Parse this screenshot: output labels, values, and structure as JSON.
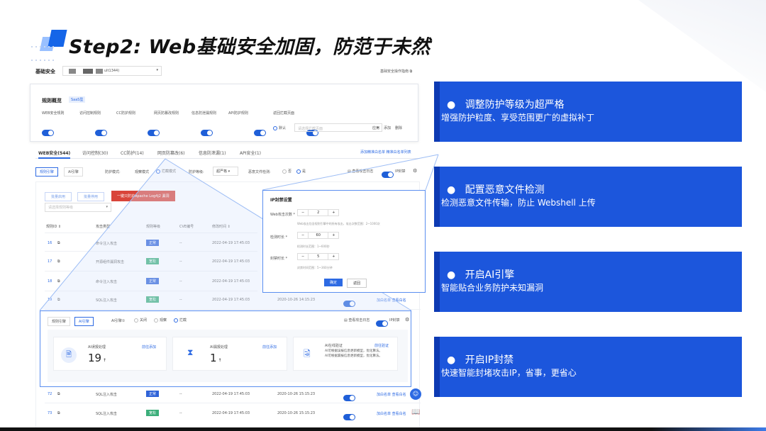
{
  "title": "Step2: Web基础安全加固，防范于未然",
  "header": {
    "section": "基础安全",
    "instance": "ult1344)",
    "guide": "基础安全操作指南"
  },
  "rules": {
    "title": "规则概览",
    "badge": "SaaS型",
    "items": [
      "WEB安全规则",
      "访问控制规则",
      "CC防护规则",
      "网页防篡改规则",
      "信息防泄漏规则",
      "API防护规则"
    ],
    "intercept": {
      "label": "返回拦截页面",
      "default": "默认",
      "placeholder": "请选择拦截页面",
      "actions": [
        "应用",
        "添加",
        "删除"
      ]
    }
  },
  "tabs": {
    "items": [
      "WEB安全(544)",
      "访问控制(30)",
      "CC防护(14)",
      "网页防篡改(6)",
      "信息防泄漏(1)",
      "API安全(1)"
    ],
    "right": "添加精准白名单 精准白名单列表"
  },
  "toolbar": {
    "tab1": "规则引擎",
    "tab2": "AI引擎",
    "mode_label": "防护模式:",
    "mode_watch": "观察模式",
    "mode_block": "拦截模式",
    "level_label": "防护等级:",
    "level_value": "超严格",
    "file_label": "恶意文件检测:",
    "file_no": "否",
    "file_yes": "是",
    "logs": "查看攻击日志",
    "ipban": "IP封禁"
  },
  "actions": {
    "enable": "批量启用",
    "disable": "批量停用",
    "log4j": "一键只防护Apache Log4j2 漏洞",
    "filter": "请选择规则等级"
  },
  "table": {
    "headers": [
      "规则ID",
      "攻击类型",
      "规则等级",
      "CVE编号",
      "修改时间"
    ],
    "rows": [
      {
        "id": "16",
        "type": "命令注入攻击",
        "level": "正常",
        "cve": "--",
        "time": "2022-04-19 17:45:03"
      },
      {
        "id": "17",
        "type": "开源组件漏洞攻击",
        "level": "宽松",
        "cve": "--",
        "time": "2022-04-19 17:45:03"
      },
      {
        "id": "18",
        "type": "命令注入攻击",
        "level": "正常",
        "cve": "--",
        "time": "2022-04-19 17:45:03"
      },
      {
        "id": "19",
        "type": "SQL注入攻击",
        "level": "宽松",
        "cve": "--",
        "time": "2022-04-19 17:45:03",
        "time2": "2020-10-26 14:15:23",
        "acts": "加白名单 查看白名"
      }
    ],
    "rows2": [
      {
        "id": "72",
        "type": "SQL注入攻击",
        "level": "正常",
        "cve": "--",
        "time": "2022-04-19 17:45:03",
        "time2": "2020-10-26 15:15:23",
        "acts": "加白名单 查看白名"
      },
      {
        "id": "73",
        "type": "SQL注入攻击",
        "level": "宽松",
        "cve": "--",
        "time": "2022-04-19 17:45:03",
        "time2": "2020-10-26 15:15:23",
        "acts": "加白名单 查看白名"
      }
    ]
  },
  "ip_dialog": {
    "title": "IP封禁设置",
    "f1": {
      "label": "Web攻击次数 *",
      "value": "2",
      "hint": "Web攻击包含规则引擎中的所有攻击，攻击次数范围：2~1000次"
    },
    "f2": {
      "label": "检测时长 *",
      "value": "60",
      "hint": "检测时长范围：1~600秒"
    },
    "f3": {
      "label": "封禁时长 *",
      "value": "5",
      "hint": "封禁时间范围：5~360分钟"
    },
    "ok": "确定",
    "cancel": "返回"
  },
  "ai": {
    "tab1": "规则引擎",
    "tab2": "AI引擎",
    "engine_label": "AI引擎①",
    "off": "关闭",
    "watch": "观察",
    "block": "拦截",
    "logs": "查看攻击日志",
    "ipban": "IP封禁",
    "c1": {
      "title": "AI误报处理",
      "link": "前往添加",
      "value": "19"
    },
    "c2": {
      "title": "AI漏报处理",
      "link": "前往添加",
      "value": "1"
    },
    "c3": {
      "title": "AI在线验证",
      "link": "前往验证",
      "l1": "AI可根据误报信息更新模型，优化算法。",
      "l2": "AI可根据漏报信息更新模型，优化算法。"
    }
  },
  "panels": [
    {
      "h": "调整防护等级为超严格",
      "s": "增强防护粒度、享受范围更广的虚拟补丁"
    },
    {
      "h": "配置恶意文件检测",
      "s": "检测恶意文件传输，防止 Webshell 上传"
    },
    {
      "h": "开启AI引擎",
      "s": "智能贴合业务防护未知漏洞"
    },
    {
      "h": "开启IP封禁",
      "s": "快速智能封堵攻击IP，省事，更省心"
    }
  ]
}
